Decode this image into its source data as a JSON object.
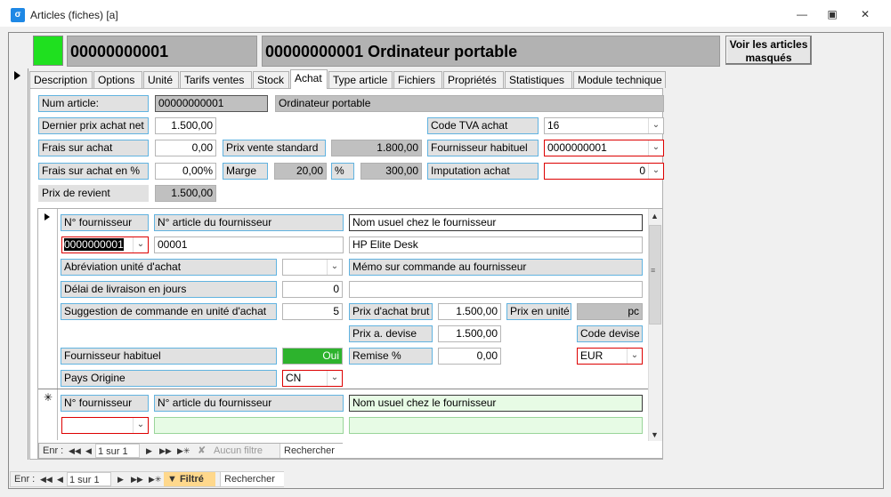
{
  "window": {
    "title": "Articles (fiches) [a]",
    "app_icon_glyph": "σ",
    "minimize_glyph": "—",
    "maximize_glyph": "▣",
    "close_glyph": "✕"
  },
  "header": {
    "status_color": "#1fe01f",
    "number": "00000000001",
    "full_name": "00000000001 Ordinateur portable",
    "masked_button": "Voir les articles masqués"
  },
  "tabs": [
    "Description",
    "Options",
    "Unité",
    "Tarifs ventes",
    "Stock",
    "Achat",
    "Type article",
    "Fichiers",
    "Propriétés",
    "Statistiques",
    "Module technique"
  ],
  "form": {
    "num_article_label": "Num article:",
    "num_article_value": "00000000001",
    "designation": "Ordinateur portable",
    "dernier_prix_label": "Dernier prix achat net",
    "dernier_prix_value": "1.500,00",
    "frais_label": "Frais sur achat",
    "frais_value": "0,00",
    "frais_pct_label": "Frais sur achat en %",
    "frais_pct_value": "0,00%",
    "prix_revient_label": "Prix de revient",
    "prix_revient_value": "1.500,00",
    "pvs_label": "Prix vente standard",
    "pvs_value": "1.800,00",
    "marge_label": "Marge",
    "marge_value": "20,00",
    "pct_label": "%",
    "marge_amount": "300,00",
    "tva_label": "Code TVA achat",
    "tva_value": "16",
    "fournisseur_label": "Fournisseur habituel",
    "fournisseur_value": "0000000001",
    "imputation_label": "Imputation achat",
    "imputation_value": "0"
  },
  "supplier": {
    "n_fournisseur_label": "N° fournisseur",
    "n_article_label": "N° article du fournisseur",
    "nom_usuel_label": "Nom usuel chez le fournisseur",
    "n_fournisseur_value": "0000000001",
    "n_article_value": "00001",
    "nom_usuel_value": "HP Elite Desk",
    "abrev_label": "Abréviation unité d'achat",
    "memo_label": "Mémo sur commande au fournisseur",
    "delai_label": "Délai de livraison en jours",
    "delai_value": "0",
    "suggestion_label": "Suggestion de commande en unité d'achat",
    "suggestion_value": "5",
    "prix_brut_label": "Prix d'achat brut",
    "prix_brut_value": "1.500,00",
    "prix_unite_label": "Prix en unité",
    "prix_unite_value": "pc",
    "prix_devise_label": "Prix a. devise",
    "prix_devise_value": "1.500,00",
    "code_devise_label": "Code devise",
    "fourn_hab_label": "Fournisseur habituel",
    "fourn_hab_value": "Oui",
    "remise_label": "Remise %",
    "remise_value": "0,00",
    "devise_value": "EUR",
    "pays_label": "Pays Origine",
    "pays_value": "CN",
    "new_row_marker": "✳"
  },
  "subnav": {
    "label": "Enr :",
    "position": "1 sur 1",
    "filter": "Aucun filtre",
    "search": "Rechercher"
  },
  "mainnav": {
    "label": "Enr :",
    "position": "1 sur 1",
    "filter": "Filtré",
    "search": "Rechercher"
  }
}
